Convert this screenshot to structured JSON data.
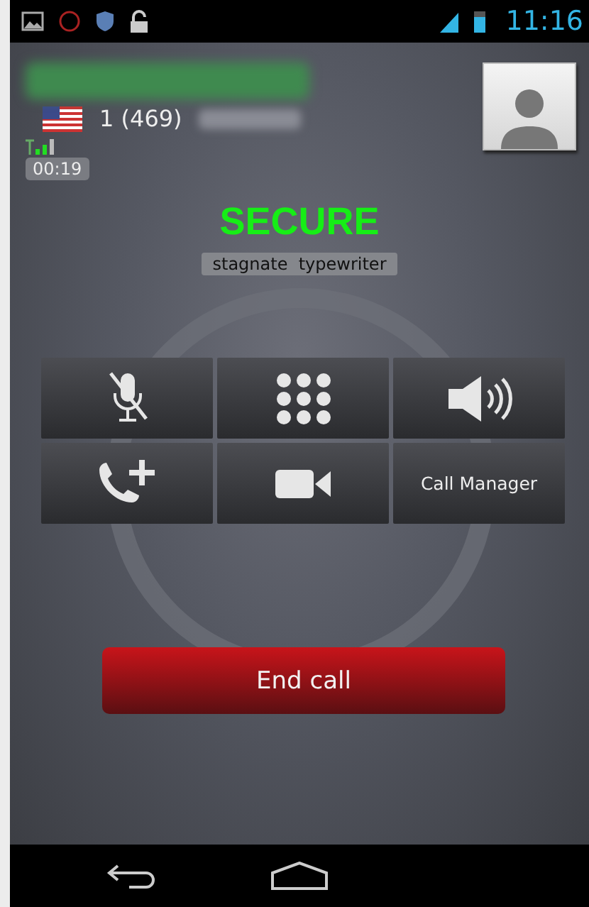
{
  "status_bar": {
    "time": "11:16"
  },
  "caller": {
    "number": "1 (469)",
    "duration": "00:19"
  },
  "security": {
    "status": "SECURE",
    "phrase": "stagnate  typewriter"
  },
  "buttons": [
    {
      "kind": "mute"
    },
    {
      "kind": "keypad"
    },
    {
      "kind": "speaker"
    },
    {
      "kind": "add-call"
    },
    {
      "kind": "video"
    },
    {
      "kind": "text",
      "label": "Call Manager"
    }
  ],
  "end_button": {
    "label": "End call"
  }
}
